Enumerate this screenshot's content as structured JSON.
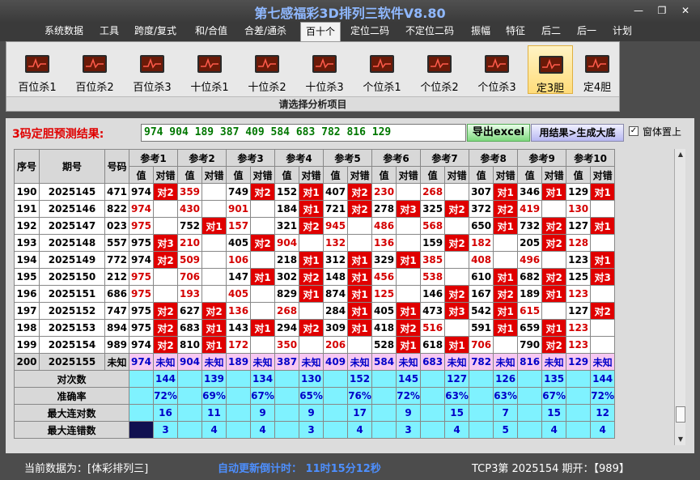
{
  "window": {
    "title": "第七感福彩3D排列三软件V8.80",
    "minimize": "—",
    "maximize": "❐",
    "close": "✕"
  },
  "menu": [
    "系统数据",
    "工具",
    "跨度/复式",
    "和/合值",
    "合差/通杀",
    "百十个",
    "定位二码",
    "不定位二码",
    "振幅",
    "特征",
    "后二",
    "后一",
    "计划"
  ],
  "menu_active": "百十个",
  "ribbon": {
    "tools": [
      "百位杀1",
      "百位杀2",
      "百位杀3",
      "十位杀1",
      "十位杀2",
      "十位杀3",
      "个位杀1",
      "个位杀2",
      "个位杀3",
      "定3胆",
      "定4胆"
    ],
    "selected": "定3胆",
    "group_label": "请选择分析项目"
  },
  "result": {
    "label": "3码定胆预测结果:",
    "value": "974 904 189 387 409 584 683 782 816 129",
    "export_button": "导出excel",
    "generate_button": "用结果>生成大底",
    "on_top_checkbox": {
      "checked": true,
      "label": "窗体置上"
    }
  },
  "table": {
    "headers": {
      "seq": "序号",
      "period": "期号",
      "number": "号码",
      "val": "值",
      "hit": "对错"
    },
    "refs": [
      "参考1",
      "参考2",
      "参考3",
      "参考4",
      "参考5",
      "参考6",
      "参考7",
      "参考8",
      "参考9",
      "参考10"
    ],
    "rows": [
      {
        "seq": "190",
        "period": "2025145",
        "number": "471",
        "cells": [
          [
            "974",
            "对2"
          ],
          [
            "359",
            ""
          ],
          [
            "749",
            "对2"
          ],
          [
            "152",
            "对1"
          ],
          [
            "407",
            "对2"
          ],
          [
            "230",
            ""
          ],
          [
            "268",
            ""
          ],
          [
            "307",
            "对1"
          ],
          [
            "346",
            "对1"
          ],
          [
            "129",
            "对1"
          ]
        ]
      },
      {
        "seq": "191",
        "period": "2025146",
        "number": "822",
        "cells": [
          [
            "974",
            ""
          ],
          [
            "430",
            ""
          ],
          [
            "901",
            ""
          ],
          [
            "184",
            "对1"
          ],
          [
            "721",
            "对2"
          ],
          [
            "278",
            "对3"
          ],
          [
            "325",
            "对2"
          ],
          [
            "372",
            "对2"
          ],
          [
            "419",
            ""
          ],
          [
            "130",
            ""
          ]
        ]
      },
      {
        "seq": "192",
        "period": "2025147",
        "number": "023",
        "cells": [
          [
            "975",
            ""
          ],
          [
            "752",
            "对1"
          ],
          [
            "157",
            ""
          ],
          [
            "321",
            "对2"
          ],
          [
            "945",
            ""
          ],
          [
            "486",
            ""
          ],
          [
            "568",
            ""
          ],
          [
            "650",
            "对1"
          ],
          [
            "732",
            "对2"
          ],
          [
            "127",
            "对1"
          ]
        ]
      },
      {
        "seq": "193",
        "period": "2025148",
        "number": "557",
        "cells": [
          [
            "975",
            "对3"
          ],
          [
            "210",
            ""
          ],
          [
            "405",
            "对2"
          ],
          [
            "904",
            ""
          ],
          [
            "132",
            ""
          ],
          [
            "136",
            ""
          ],
          [
            "159",
            "对2"
          ],
          [
            "182",
            ""
          ],
          [
            "205",
            "对2"
          ],
          [
            "128",
            ""
          ]
        ]
      },
      {
        "seq": "194",
        "period": "2025149",
        "number": "772",
        "cells": [
          [
            "974",
            "对2"
          ],
          [
            "509",
            ""
          ],
          [
            "106",
            ""
          ],
          [
            "218",
            "对1"
          ],
          [
            "312",
            "对1"
          ],
          [
            "329",
            "对1"
          ],
          [
            "385",
            ""
          ],
          [
            "408",
            ""
          ],
          [
            "496",
            ""
          ],
          [
            "123",
            "对1"
          ]
        ]
      },
      {
        "seq": "195",
        "period": "2025150",
        "number": "212",
        "cells": [
          [
            "975",
            ""
          ],
          [
            "706",
            ""
          ],
          [
            "147",
            "对1"
          ],
          [
            "302",
            "对2"
          ],
          [
            "148",
            "对1"
          ],
          [
            "456",
            ""
          ],
          [
            "538",
            ""
          ],
          [
            "610",
            "对1"
          ],
          [
            "682",
            "对2"
          ],
          [
            "125",
            "对3"
          ]
        ]
      },
      {
        "seq": "196",
        "period": "2025151",
        "number": "686",
        "cells": [
          [
            "975",
            ""
          ],
          [
            "193",
            ""
          ],
          [
            "405",
            ""
          ],
          [
            "829",
            "对1"
          ],
          [
            "874",
            "对1"
          ],
          [
            "125",
            ""
          ],
          [
            "146",
            "对2"
          ],
          [
            "167",
            "对2"
          ],
          [
            "189",
            "对1"
          ],
          [
            "123",
            ""
          ]
        ]
      },
      {
        "seq": "197",
        "period": "2025152",
        "number": "747",
        "cells": [
          [
            "975",
            "对2"
          ],
          [
            "627",
            "对2"
          ],
          [
            "136",
            ""
          ],
          [
            "268",
            ""
          ],
          [
            "284",
            "对1"
          ],
          [
            "405",
            "对1"
          ],
          [
            "473",
            "对3"
          ],
          [
            "542",
            "对1"
          ],
          [
            "615",
            ""
          ],
          [
            "127",
            "对2"
          ]
        ]
      },
      {
        "seq": "198",
        "period": "2025153",
        "number": "894",
        "cells": [
          [
            "975",
            "对2"
          ],
          [
            "683",
            "对1"
          ],
          [
            "143",
            "对1"
          ],
          [
            "294",
            "对2"
          ],
          [
            "309",
            "对1"
          ],
          [
            "418",
            "对2"
          ],
          [
            "516",
            ""
          ],
          [
            "591",
            "对1"
          ],
          [
            "659",
            "对1"
          ],
          [
            "123",
            ""
          ]
        ]
      },
      {
        "seq": "199",
        "period": "2025154",
        "number": "989",
        "cells": [
          [
            "974",
            "对2"
          ],
          [
            "810",
            "对1"
          ],
          [
            "172",
            ""
          ],
          [
            "350",
            ""
          ],
          [
            "206",
            ""
          ],
          [
            "528",
            "对1"
          ],
          [
            "618",
            "对1"
          ],
          [
            "706",
            ""
          ],
          [
            "790",
            "对2"
          ],
          [
            "123",
            ""
          ]
        ]
      }
    ],
    "prediction_row": {
      "seq": "200",
      "period": "2025155",
      "number": "未知",
      "values": [
        "974",
        "904",
        "189",
        "387",
        "409",
        "584",
        "683",
        "782",
        "816",
        "129"
      ],
      "unknown": "未知"
    },
    "stats": [
      {
        "label": "对次数",
        "values": [
          "144",
          "139",
          "134",
          "130",
          "152",
          "145",
          "127",
          "126",
          "135",
          "144"
        ]
      },
      {
        "label": "准确率",
        "values": [
          "72%",
          "69%",
          "67%",
          "65%",
          "76%",
          "72%",
          "63%",
          "63%",
          "67%",
          "72%"
        ]
      },
      {
        "label": "最大连对数",
        "values": [
          "16",
          "11",
          "9",
          "9",
          "17",
          "9",
          "15",
          "7",
          "15",
          "12"
        ]
      },
      {
        "label": "最大连错数",
        "values": [
          "3",
          "4",
          "4",
          "3",
          "4",
          "3",
          "4",
          "5",
          "4",
          "4"
        ]
      }
    ]
  },
  "status": {
    "current_data": "当前数据为：[体彩排列三]",
    "countdown": "自动更新倒计时：  11时15分12秒",
    "draw": "TCP3第 2025154 期开：【989】"
  },
  "colors": {
    "hit": "#e00000",
    "miss_value": "#d40000",
    "prediction_row": "#f7c8f2",
    "stats_row": "#7ff2ff",
    "stats_text": "#0000c8"
  }
}
